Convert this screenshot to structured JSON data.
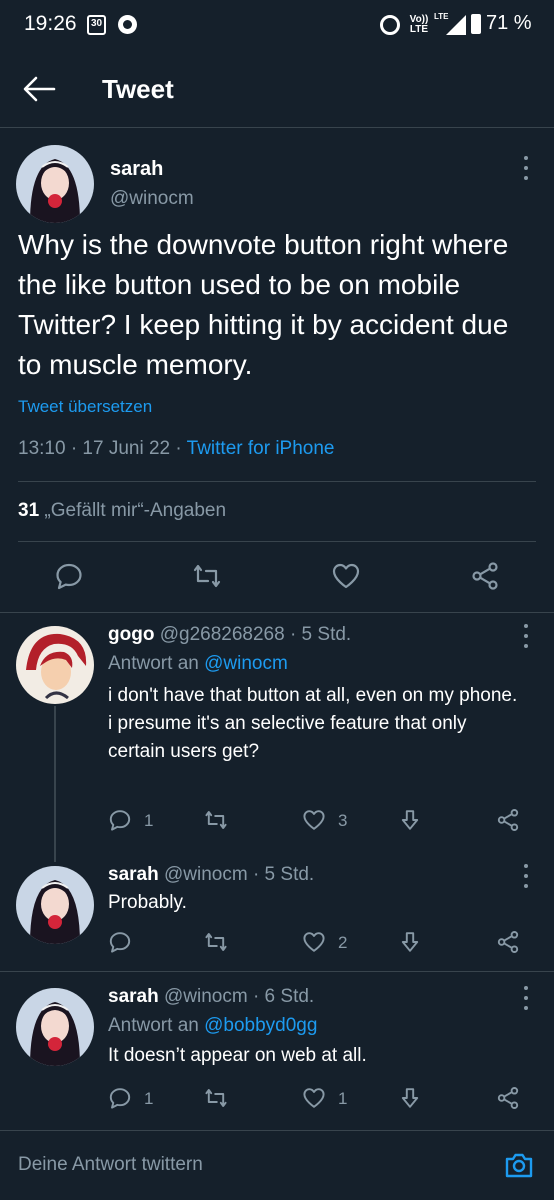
{
  "status_bar": {
    "time": "19:26",
    "calendar_day": "30",
    "volte": "Vo)) LTE",
    "lte": "LTE",
    "battery": "71 %"
  },
  "header": {
    "title": "Tweet"
  },
  "tweet": {
    "name": "sarah",
    "handle": "@winocm",
    "text": "Why is the downvote button right where the like button used to be on mobile Twitter? I keep hitting it by accident due to muscle memory.",
    "translate": "Tweet übersetzen",
    "time_date": "13:10 · 17 Juni 22 · ",
    "client": "Twitter for iPhone",
    "likes_count": "31",
    "likes_label": " „Gefällt mir“-Angaben"
  },
  "replies": [
    {
      "name": "gogo",
      "meta": " @g268268268 · 5 Std.",
      "reply_to_label": "Antwort an ",
      "reply_to_handle": "@winocm",
      "text_1": "i don't have that button at all, even on my phone.",
      "text_2": "i presume it's an selective feature that only certain users get?",
      "reply_count": "1",
      "retweet_count": "",
      "like_count": "3"
    },
    {
      "name": "sarah",
      "meta": " @winocm · 5 Std.",
      "text_1": "Probably.",
      "reply_count": "",
      "like_count": "2"
    },
    {
      "name": "sarah",
      "meta": " @winocm · 6 Std.",
      "reply_to_label": "Antwort an ",
      "reply_to_handle": "@bobbyd0gg",
      "text_1": "It doesn’t appear on web at all.",
      "reply_count": "1",
      "like_count": "1"
    }
  ],
  "reply_bar": {
    "placeholder": "Deine Antwort twittern"
  },
  "colors": {
    "background": "#15202b",
    "accent": "#1d9bf0",
    "secondary_text": "#8899a6",
    "divider": "#38444d"
  }
}
